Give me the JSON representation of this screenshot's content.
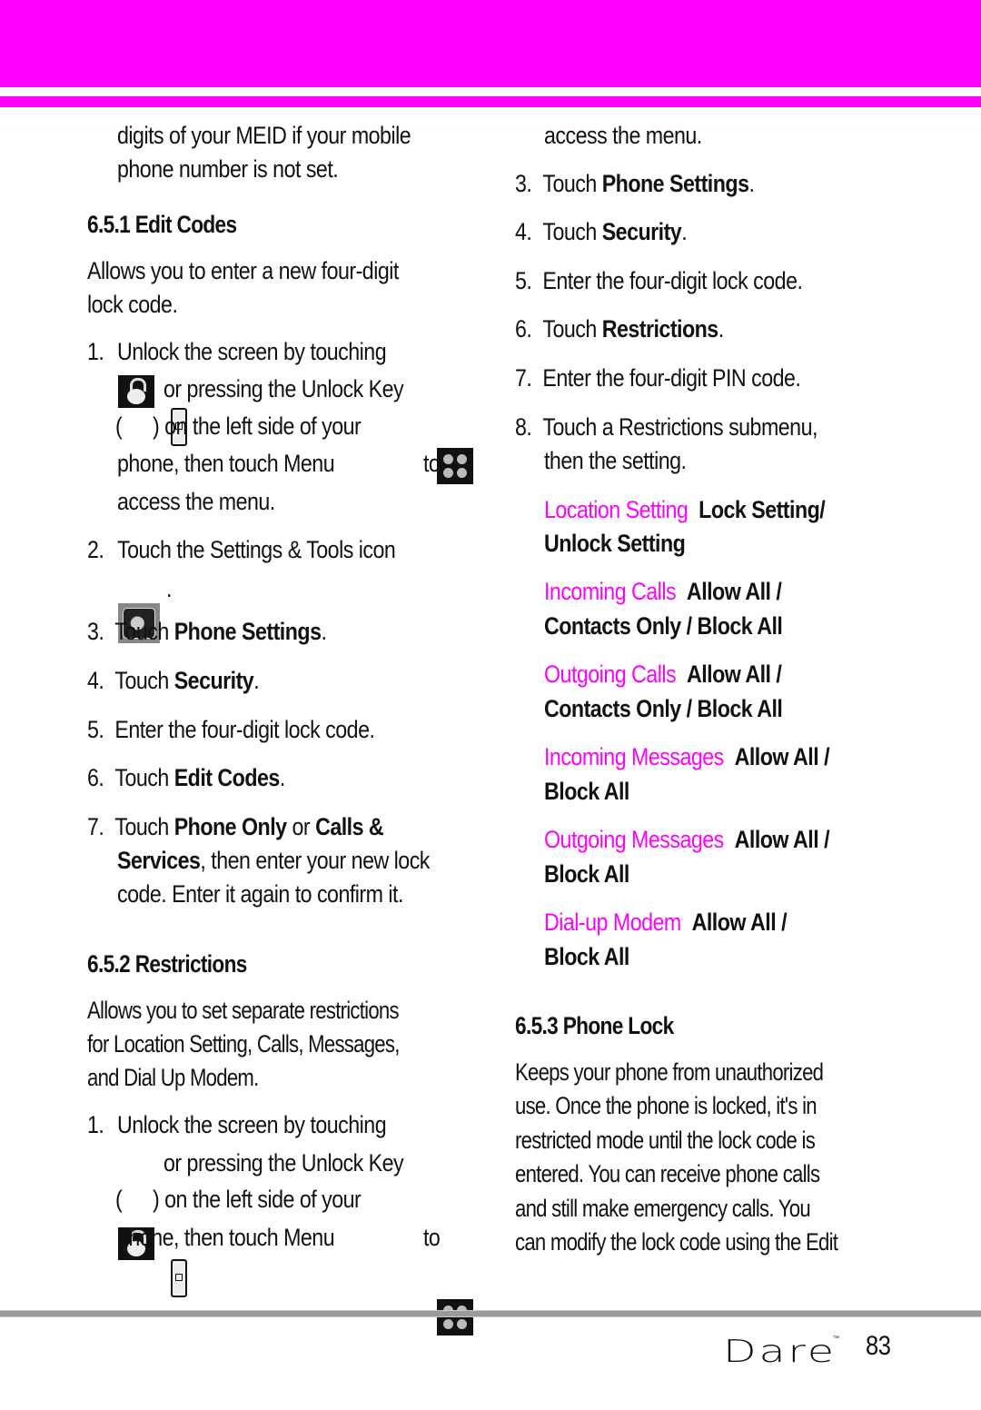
{
  "colors": {
    "accent": "#ff00ff",
    "text": "#111111",
    "rule": "#9a9a9a"
  },
  "left": {
    "intro_lines": [
      "digits of your MEID if your mobile",
      "phone number is not set."
    ],
    "sec1": {
      "heading": "6.5.1 Edit Codes",
      "desc_lines": [
        "Allows you to enter a new four-digit",
        "lock code."
      ],
      "steps": {
        "s1": {
          "num": "1.",
          "l1": "Unlock the screen by touching",
          "l2": "or pressing the Unlock Key",
          "l3_open": "(",
          "l3_close": ") on the left side of your",
          "l4": "phone, then touch Menu",
          "l4_end": "to",
          "l5": "access the menu."
        },
        "s2": {
          "num": "2.",
          "l1": "Touch the Settings & Tools icon",
          "l2": "."
        },
        "s3": {
          "num": "3.",
          "pre": "Touch ",
          "bold": "Phone Settings",
          "post": "."
        },
        "s4": {
          "num": "4.",
          "pre": "Touch ",
          "bold": "Security",
          "post": "."
        },
        "s5": {
          "num": "5.",
          "text": "Enter the four-digit lock code."
        },
        "s6": {
          "num": "6.",
          "pre": "Touch ",
          "bold": "Edit Codes",
          "post": "."
        },
        "s7": {
          "num": "7.",
          "pre": "Touch ",
          "bold1": "Phone Only",
          "mid": " or ",
          "bold2": "Calls &",
          "bold3": "Services",
          "l2_post": ", then enter your new lock",
          "l3": "code. Enter it again to confirm it."
        }
      }
    },
    "sec2": {
      "heading": "6.5.2 Restrictions",
      "desc_lines": [
        "Allows you to set separate restrictions",
        "for Location Setting, Calls, Messages,",
        "and Dial Up Modem."
      ],
      "s1": {
        "num": "1.",
        "l1": "Unlock the screen by touching",
        "l2": "or pressing the Unlock Key",
        "l3_open": "(",
        "l3_close": ") on the left side of your",
        "l4": "phone, then touch Menu",
        "l4_end": "to"
      }
    }
  },
  "right": {
    "cont": "access the menu.",
    "s3": {
      "num": "3.",
      "pre": "Touch ",
      "bold": "Phone Settings",
      "post": "."
    },
    "s4": {
      "num": "4.",
      "pre": "Touch ",
      "bold": "Security",
      "post": "."
    },
    "s5": {
      "num": "5.",
      "text": "Enter the four-digit lock code."
    },
    "s6": {
      "num": "6.",
      "pre": "Touch ",
      "bold": "Restrictions",
      "post": "."
    },
    "s7": {
      "num": "7.",
      "text": "Enter the four-digit PIN code."
    },
    "s8": {
      "num": "8.",
      "l1": "Touch a Restrictions submenu,",
      "l2": "then the setting."
    },
    "options": [
      {
        "name": "Location Setting",
        "v1": "Lock Setting/",
        "v2": "Unlock Setting"
      },
      {
        "name": "Incoming Calls",
        "v1": "Allow All /",
        "v2": "Contacts Only / Block All"
      },
      {
        "name": "Outgoing Calls",
        "v1": "Allow All /",
        "v2": "Contacts Only / Block All"
      },
      {
        "name": "Incoming Messages",
        "v1": "Allow All /",
        "v2": "Block All"
      },
      {
        "name": "Outgoing Messages",
        "v1": "Allow All /",
        "v2": "Block All"
      },
      {
        "name": "Dial-up Modem",
        "v1": "Allow All /",
        "v2": "Block All"
      }
    ],
    "sec3": {
      "heading": "6.5.3 Phone Lock",
      "desc_lines": [
        "Keeps your phone from unauthorized",
        "use. Once the phone is locked, it's in",
        "restricted mode until the lock code is",
        "entered. You can receive phone calls",
        "and still make emergency calls. You",
        "can modify the lock code using the Edit"
      ]
    }
  },
  "footer": {
    "brand": "Dare",
    "tm": "™",
    "page_number": "83"
  },
  "icons": {
    "lock": "unlock-screen-icon",
    "key": "unlock-key-icon",
    "menu": "menu-icon",
    "settings": "settings-tools-icon"
  }
}
